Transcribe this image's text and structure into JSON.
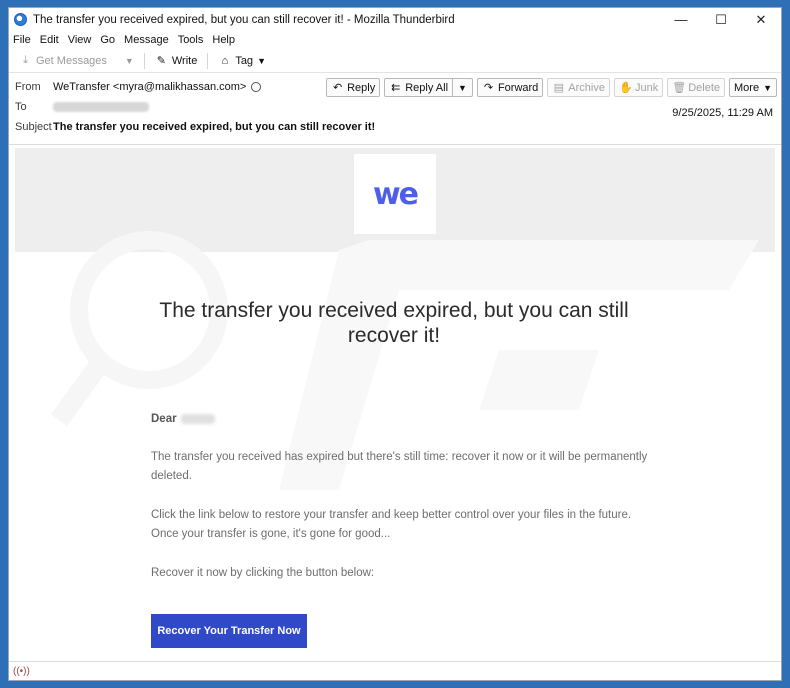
{
  "window": {
    "title": "The transfer you received expired, but you can still recover it! - Mozilla Thunderbird",
    "controls": {
      "minimize": "—",
      "maximize": "☐",
      "close": "✕"
    }
  },
  "menu": [
    {
      "label": "File"
    },
    {
      "label": "Edit"
    },
    {
      "label": "View"
    },
    {
      "label": "Go"
    },
    {
      "label": "Message"
    },
    {
      "label": "Tools"
    },
    {
      "label": "Help"
    }
  ],
  "toolbar": {
    "get_messages": "Get Messages",
    "write": "Write",
    "tag": "Tag"
  },
  "header": {
    "from_label": "From",
    "from_value": "WeTransfer <myra@malikhassan.com>",
    "to_label": "To",
    "subject_label": "Subject",
    "subject_value": "The transfer you received expired, but you can still recover it!",
    "date": "9/25/2025, 11:29 AM",
    "actions": {
      "reply": "Reply",
      "reply_all": "Reply All",
      "forward": "Forward",
      "archive": "Archive",
      "junk": "Junk",
      "delete": "Delete",
      "more": "More"
    }
  },
  "email": {
    "logo": "we",
    "headline": "The transfer you received expired, but you can still recover it!",
    "dear": "Dear",
    "para1": "The transfer you received  has expired but there's still time: recover it now or it will be permanently deleted.",
    "para2": "Click the link below to restore your transfer and keep better control over your files in the future. Once your transfer is gone, it's gone for good...",
    "para3": "Recover it now by clicking the button below:",
    "cta": "Recover Your Transfer Now"
  },
  "colors": {
    "accent": "#2f49c8",
    "logo": "#4d5fe8",
    "banner": "#eeeeee"
  }
}
